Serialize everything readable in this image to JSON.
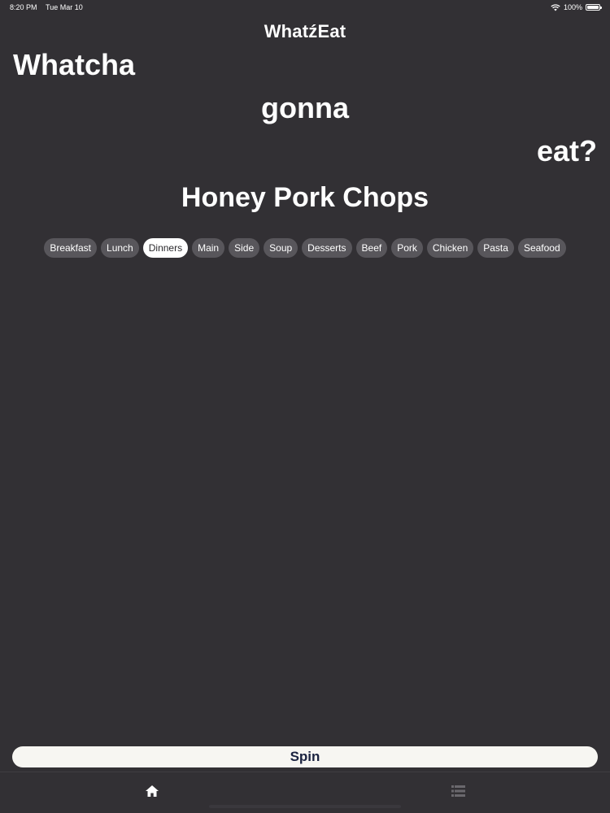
{
  "status_bar": {
    "time": "8:20 PM",
    "date": "Tue Mar 10",
    "battery": "100%"
  },
  "logo": {
    "text": "WhatźEat"
  },
  "heading": {
    "word1": "Whatcha",
    "word2": "gonna",
    "word3": "eat?"
  },
  "result": {
    "title": "Honey Pork Chops"
  },
  "categories": [
    {
      "label": "Breakfast",
      "selected": false
    },
    {
      "label": "Lunch",
      "selected": false
    },
    {
      "label": "Dinners",
      "selected": true
    },
    {
      "label": "Main",
      "selected": false
    },
    {
      "label": "Side",
      "selected": false
    },
    {
      "label": "Soup",
      "selected": false
    },
    {
      "label": "Desserts",
      "selected": false
    },
    {
      "label": "Beef",
      "selected": false
    },
    {
      "label": "Pork",
      "selected": false
    },
    {
      "label": "Chicken",
      "selected": false
    },
    {
      "label": "Pasta",
      "selected": false
    },
    {
      "label": "Seafood",
      "selected": false
    }
  ],
  "spin_button": {
    "label": "Spin"
  },
  "tab_bar": {
    "tabs": [
      {
        "icon": "home-icon",
        "selected": true
      },
      {
        "icon": "list-icon",
        "selected": false
      }
    ]
  }
}
